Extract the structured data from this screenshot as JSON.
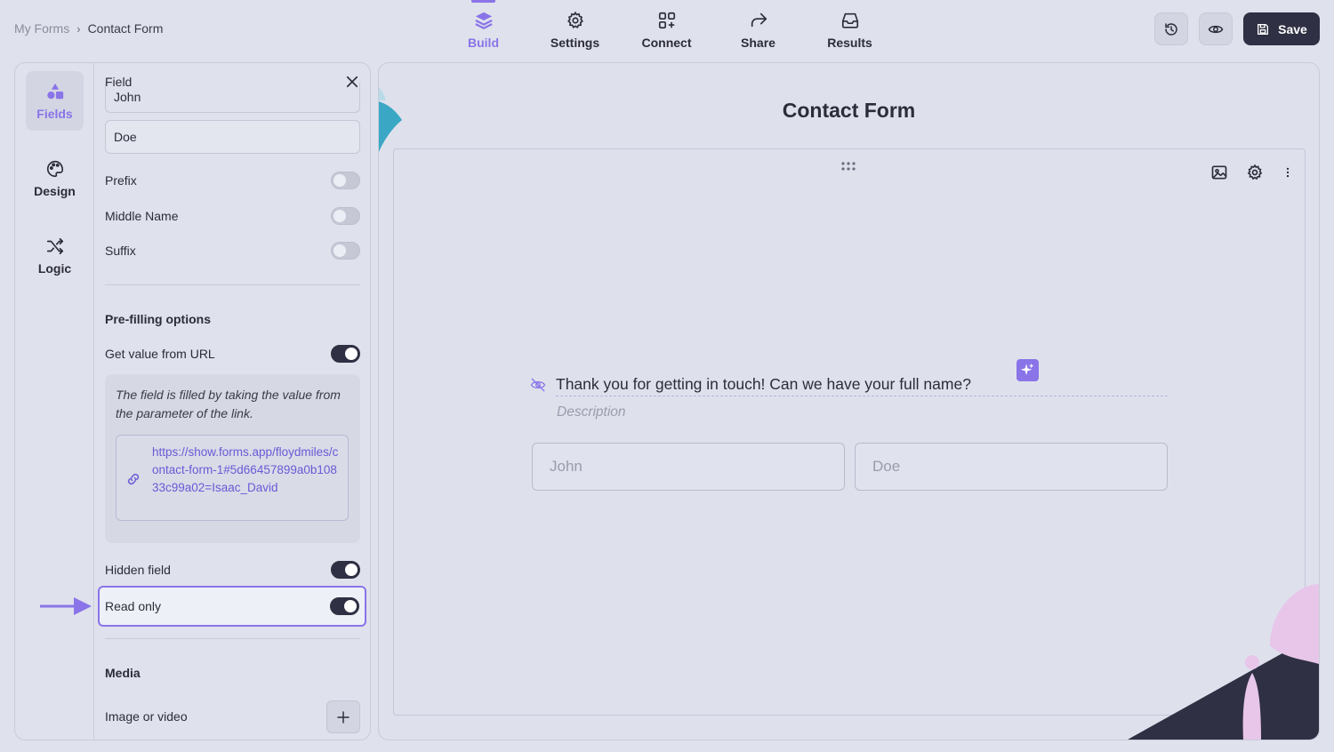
{
  "breadcrumb": {
    "root": "My Forms",
    "separator": "›",
    "current": "Contact Form"
  },
  "nav": {
    "tabs": [
      {
        "label": "Build",
        "icon": "layers-icon",
        "active": true
      },
      {
        "label": "Settings",
        "icon": "gear-icon",
        "active": false
      },
      {
        "label": "Connect",
        "icon": "grid-plus-icon",
        "active": false
      },
      {
        "label": "Share",
        "icon": "share-arrow-icon",
        "active": false
      },
      {
        "label": "Results",
        "icon": "inbox-icon",
        "active": false
      }
    ]
  },
  "actions": {
    "save_label": "Save"
  },
  "rail": {
    "items": [
      {
        "label": "Fields",
        "icon": "shapes-icon",
        "active": true
      },
      {
        "label": "Design",
        "icon": "palette-icon",
        "active": false
      },
      {
        "label": "Logic",
        "icon": "shuffle-icon",
        "active": false
      }
    ]
  },
  "props": {
    "field_label": "Field",
    "first_name_value": "John",
    "last_name_value": "Doe",
    "toggles": {
      "prefix": {
        "label": "Prefix",
        "on": false
      },
      "middle_name": {
        "label": "Middle Name",
        "on": false
      },
      "suffix": {
        "label": "Suffix",
        "on": false
      },
      "url_value": {
        "label": "Get value from URL",
        "on": true
      },
      "hidden": {
        "label": "Hidden field",
        "on": true
      },
      "read_only": {
        "label": "Read only",
        "on": true
      }
    },
    "prefill_heading": "Pre-filling options",
    "prefill_info": "The field is filled by taking the value from the parameter of the link.",
    "prefill_url": "https://show.forms.app/floydmiles/contact-form-1#5d66457899a0b10833c99a02=Isaac_David",
    "media_heading": "Media",
    "media_label": "Image or video"
  },
  "canvas": {
    "title": "Contact Form",
    "question": "Thank you for getting in touch! Can we have your full name?",
    "description_placeholder": "Description",
    "first_placeholder": "John",
    "last_placeholder": "Doe"
  },
  "colors": {
    "accent": "#8a74e8",
    "dark": "#2f3043",
    "background": "#dfe1ec",
    "teal": "#3aa7c4",
    "pink": "#e7c6ea"
  }
}
